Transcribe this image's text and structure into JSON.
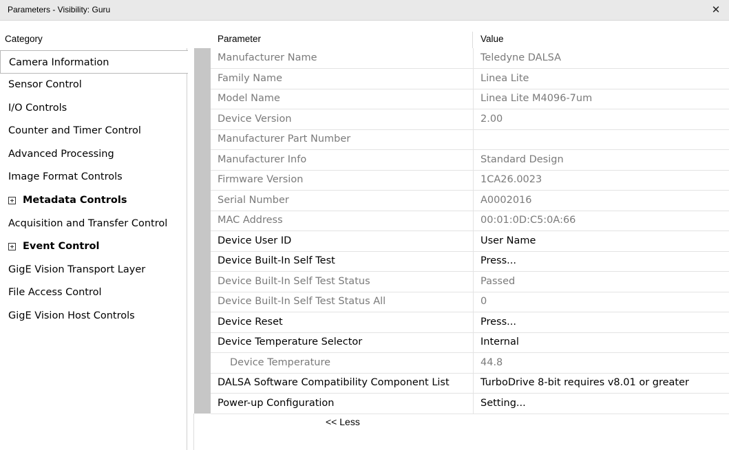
{
  "window": {
    "title": "Parameters - Visibility: Guru",
    "close_glyph": "✕"
  },
  "headers": {
    "category": "Category",
    "parameter": "Parameter",
    "value": "Value"
  },
  "categories": [
    {
      "label": "Camera Information",
      "selected": true,
      "expandable": false
    },
    {
      "label": "Sensor Control",
      "selected": false,
      "expandable": false
    },
    {
      "label": "I/O Controls",
      "selected": false,
      "expandable": false
    },
    {
      "label": "Counter and Timer Control",
      "selected": false,
      "expandable": false
    },
    {
      "label": "Advanced Processing",
      "selected": false,
      "expandable": false
    },
    {
      "label": "Image Format Controls",
      "selected": false,
      "expandable": false
    },
    {
      "label": "Metadata Controls",
      "selected": false,
      "expandable": true
    },
    {
      "label": "Acquisition and Transfer Control",
      "selected": false,
      "expandable": false
    },
    {
      "label": "Event Control",
      "selected": false,
      "expandable": true
    },
    {
      "label": "GigE Vision Transport Layer",
      "selected": false,
      "expandable": false
    },
    {
      "label": "File Access Control",
      "selected": false,
      "expandable": false
    },
    {
      "label": "GigE Vision Host Controls",
      "selected": false,
      "expandable": false
    }
  ],
  "parameters": [
    {
      "name": "Manufacturer Name",
      "value": "Teledyne DALSA",
      "readonly": true,
      "indent": false
    },
    {
      "name": "Family Name",
      "value": "Linea Lite",
      "readonly": true,
      "indent": false
    },
    {
      "name": "Model Name",
      "value": "Linea Lite M4096-7um",
      "readonly": true,
      "indent": false
    },
    {
      "name": "Device Version",
      "value": "2.00",
      "readonly": true,
      "indent": false
    },
    {
      "name": "Manufacturer Part Number",
      "value": "",
      "readonly": true,
      "indent": false
    },
    {
      "name": "Manufacturer Info",
      "value": "Standard Design",
      "readonly": true,
      "indent": false
    },
    {
      "name": "Firmware Version",
      "value": "1CA26.0023",
      "readonly": true,
      "indent": false
    },
    {
      "name": "Serial Number",
      "value": "A0002016",
      "readonly": true,
      "indent": false
    },
    {
      "name": "MAC Address",
      "value": "00:01:0D:C5:0A:66",
      "readonly": true,
      "indent": false
    },
    {
      "name": "Device User ID",
      "value": "User Name",
      "readonly": false,
      "indent": false
    },
    {
      "name": "Device Built-In Self Test",
      "value": "Press...",
      "readonly": false,
      "indent": false
    },
    {
      "name": "Device Built-In Self Test Status",
      "value": "Passed",
      "readonly": true,
      "indent": false
    },
    {
      "name": "Device Built-In Self Test Status All",
      "value": "0",
      "readonly": true,
      "indent": false
    },
    {
      "name": "Device Reset",
      "value": "Press...",
      "readonly": false,
      "indent": false
    },
    {
      "name": "Device Temperature Selector",
      "value": "Internal",
      "readonly": false,
      "indent": false
    },
    {
      "name": "Device Temperature",
      "value": "44.8",
      "readonly": true,
      "indent": true
    },
    {
      "name": "DALSA Software Compatibility Component List",
      "value": "TurboDrive 8-bit requires v8.01 or greater",
      "readonly": false,
      "indent": false
    },
    {
      "name": "Power-up Configuration",
      "value": "Setting...",
      "readonly": false,
      "indent": false
    }
  ],
  "less_link": "<< Less",
  "colors": {
    "readonly_text": "#7a7a7a",
    "gutter": "#c6c6c6",
    "titlebar": "#e9e9e9"
  }
}
